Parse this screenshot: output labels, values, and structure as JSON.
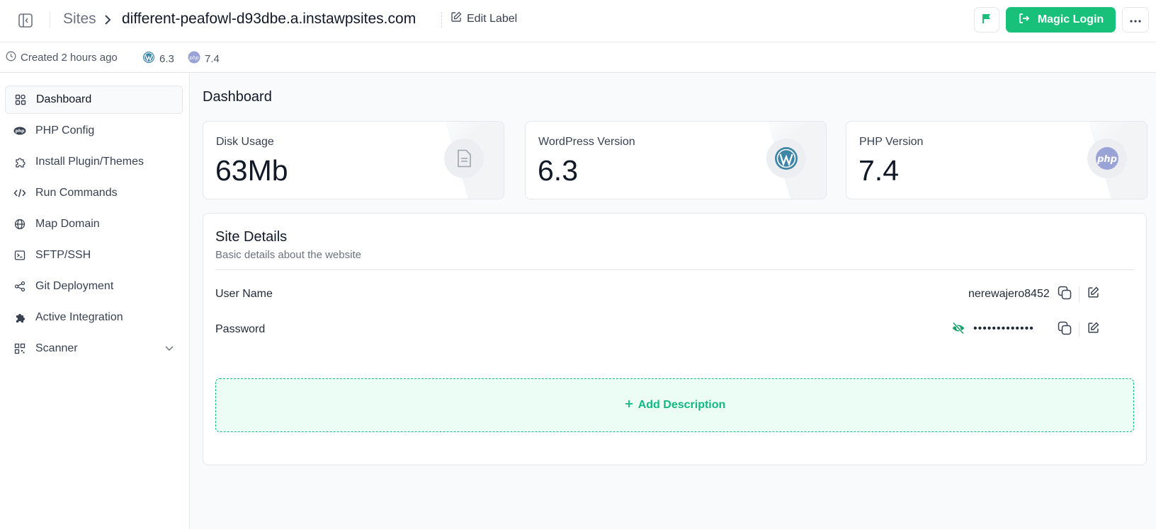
{
  "header": {
    "breadcrumb_root": "Sites",
    "site_name": "different-peafowl-d93dbe.a.instawpsites.com",
    "edit_label": "Edit Label",
    "magic_login": "Magic Login"
  },
  "meta": {
    "created": "Created 2 hours ago",
    "wp_version": "6.3",
    "php_version": "7.4"
  },
  "sidebar": {
    "items": [
      {
        "label": "Dashboard",
        "icon": "grid-icon"
      },
      {
        "label": "PHP Config",
        "icon": "php-icon"
      },
      {
        "label": "Install Plugin/Themes",
        "icon": "puzzle-icon"
      },
      {
        "label": "Run Commands",
        "icon": "code-icon"
      },
      {
        "label": "Map Domain",
        "icon": "globe-icon"
      },
      {
        "label": "SFTP/SSH",
        "icon": "terminal-icon"
      },
      {
        "label": "Git Deployment",
        "icon": "share-icon"
      },
      {
        "label": "Active Integration",
        "icon": "puzzle-solid-icon"
      },
      {
        "label": "Scanner",
        "icon": "qr-icon"
      }
    ]
  },
  "main": {
    "title": "Dashboard",
    "cards": [
      {
        "label": "Disk Usage",
        "value": "63Mb",
        "icon": "document-icon"
      },
      {
        "label": "WordPress Version",
        "value": "6.3",
        "icon": "wordpress-icon"
      },
      {
        "label": "PHP Version",
        "value": "7.4",
        "icon": "php-icon"
      }
    ],
    "details": {
      "title": "Site Details",
      "subtitle": "Basic details about the website",
      "username_label": "User Name",
      "username_value": "nerewajero8452",
      "password_label": "Password",
      "password_value": "•••••••••••••",
      "add_description": "Add Description"
    }
  },
  "colors": {
    "accent": "#18c07a",
    "accent_light": "#ecfdf5"
  }
}
